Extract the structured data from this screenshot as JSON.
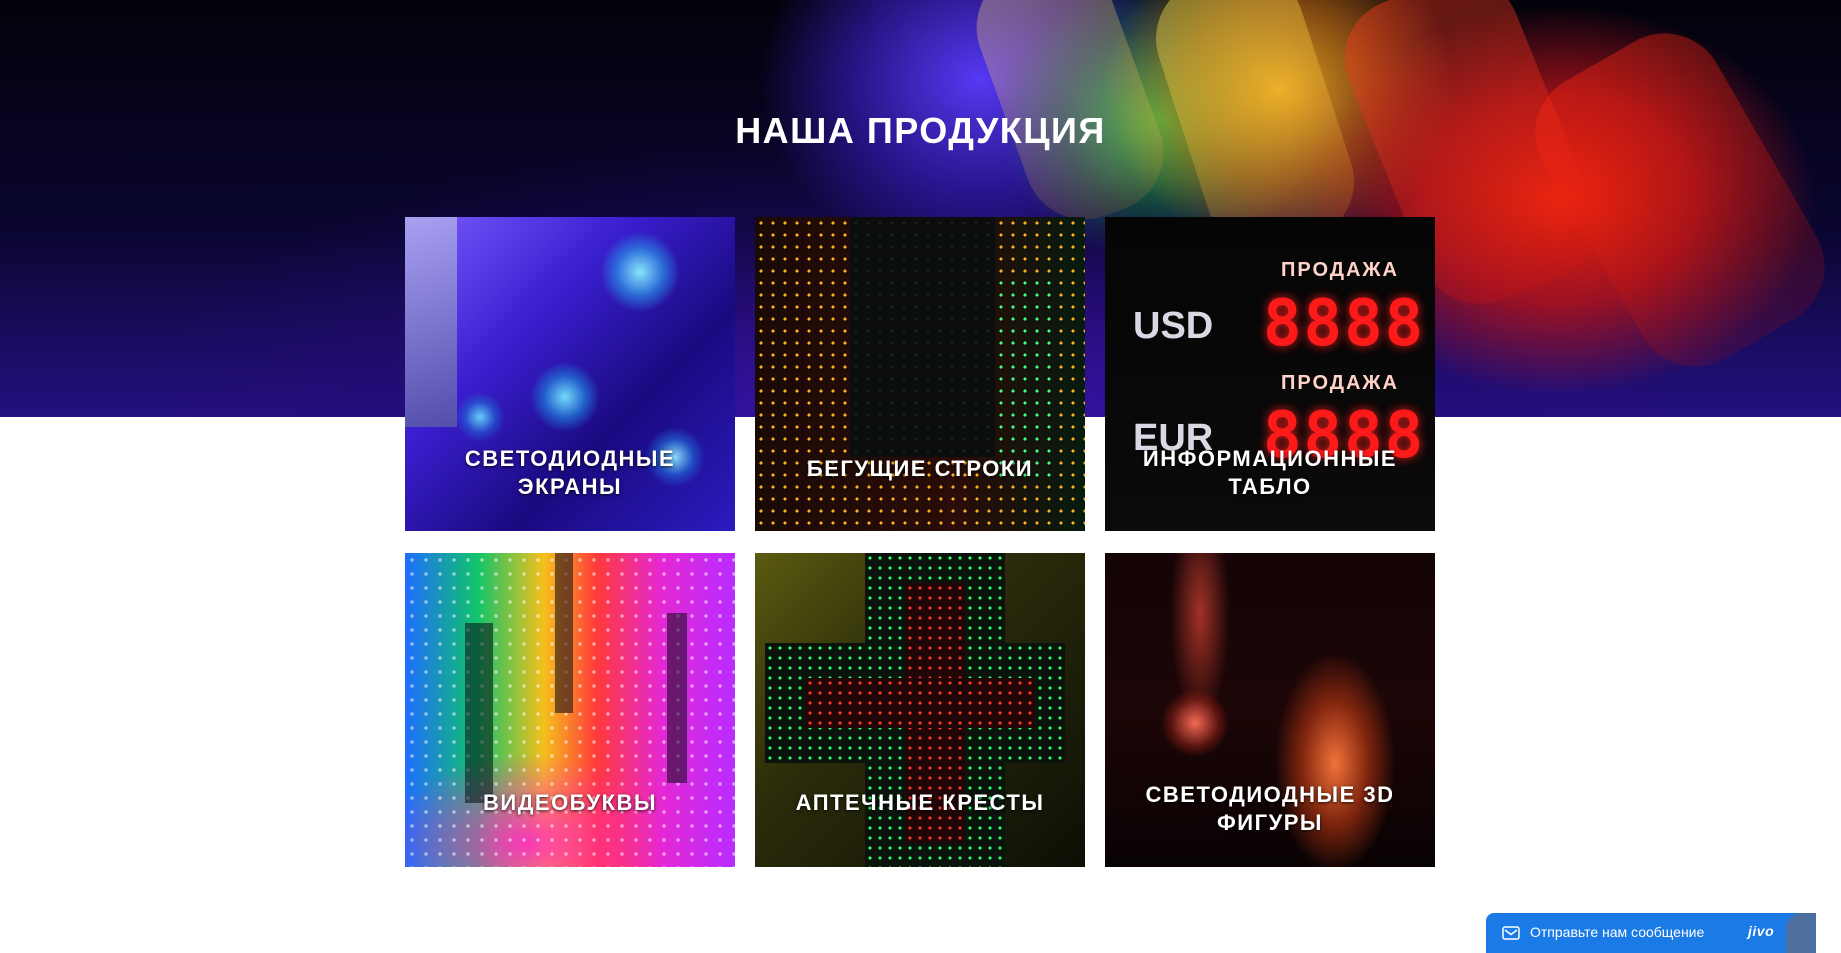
{
  "section": {
    "title": "НАША ПРОДУКЦИЯ"
  },
  "products": [
    {
      "label": "СВЕТОДИОДНЫЕ ЭКРАНЫ"
    },
    {
      "label": "БЕГУЩИЕ СТРОКИ"
    },
    {
      "label": "ИНФОРМАЦИОННЫЕ ТАБЛО"
    },
    {
      "label": "ВИДЕОБУКВЫ"
    },
    {
      "label": "АПТЕЧНЫЕ КРЕСТЫ"
    },
    {
      "label": "СВЕТОДИОДНЫЕ 3D ФИГУРЫ"
    }
  ],
  "board_image": {
    "sale_caption_1": "ПРОДАЖА",
    "sale_caption_2": "ПРОДАЖА",
    "currency_1": "USD",
    "currency_2": "EUR",
    "digits_1": "8888",
    "digits_2": "8888"
  },
  "chat": {
    "text": "Отправьте нам сообщение",
    "brand": "jivo",
    "icon": "mail-icon"
  },
  "colors": {
    "chat_background": "#1a7be6",
    "title_text": "#ffffff",
    "page_background": "#ffffff"
  }
}
